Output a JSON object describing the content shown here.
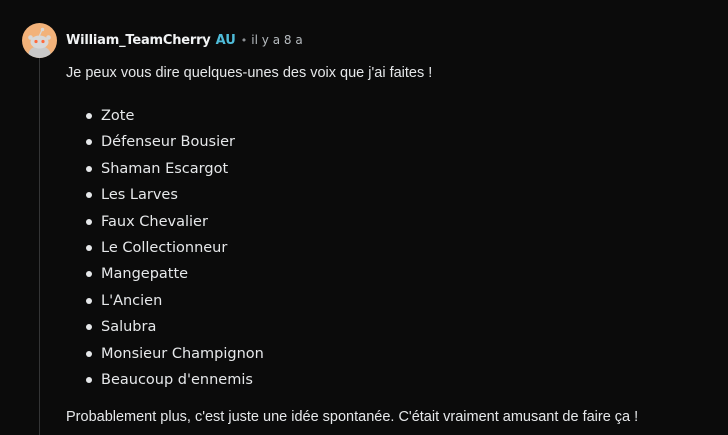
{
  "comment": {
    "author": "William_TeamCherry",
    "flair": "AU",
    "separator": "•",
    "time": "il y a 8 a",
    "intro": "Je peux vous dire quelques-unes des voix que j'ai faites !",
    "voices": [
      "Zote",
      "Défenseur Bousier",
      "Shaman Escargot",
      "Les Larves",
      "Faux Chevalier",
      "Le Collectionneur",
      "Mangepatte",
      "L'Ancien",
      "Salubra",
      "Monsieur Champignon",
      "Beaucoup d'ennemis"
    ],
    "outro": "Probablement plus, c'est juste une idée spontanée. C'était vraiment amusant de faire ça !"
  },
  "colors": {
    "background": "#0b0b0b",
    "text": "#e6e8ea",
    "flair": "#4fbcd9",
    "avatar_bg": "#f2b27a",
    "thread_line": "#343536"
  },
  "icons": {
    "avatar": "snoo-avatar-icon"
  }
}
